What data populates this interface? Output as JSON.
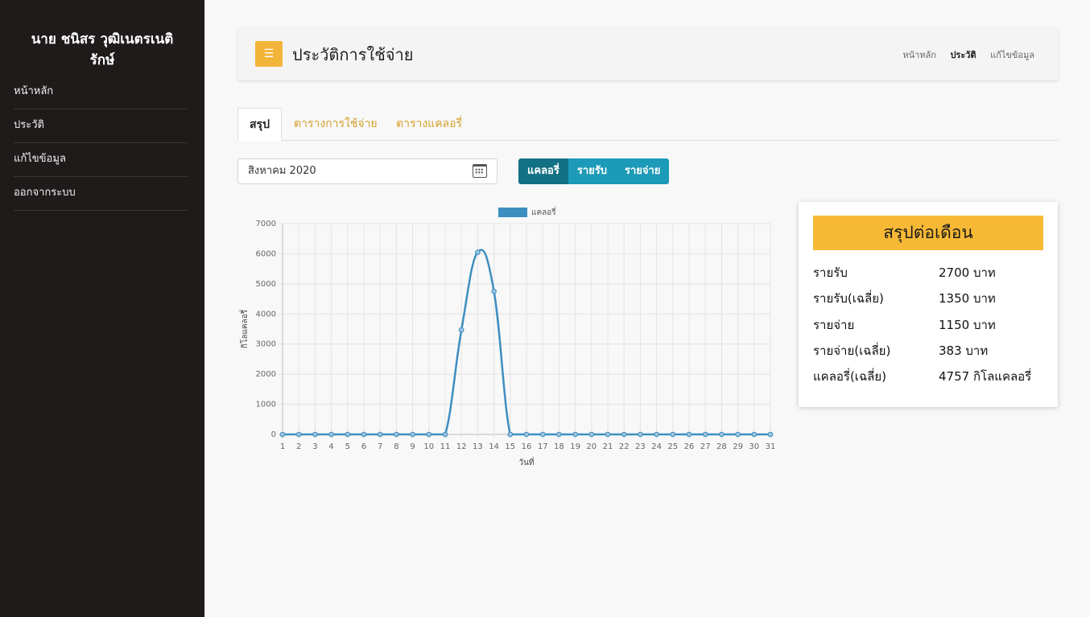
{
  "sidebar": {
    "user_name": "นาย ชนิสร วุฒิเนตรเนติรักษ์",
    "items": [
      {
        "label": "หน้าหลัก"
      },
      {
        "label": "ประวัติ"
      },
      {
        "label": "แก้ไขข้อมูล"
      },
      {
        "label": "ออกจากระบบ"
      }
    ]
  },
  "header": {
    "menu_icon": "list-icon",
    "title": "ประวัติการใช้จ่าย",
    "breadcrumbs": [
      "หน้าหลัก",
      "ประวัติ",
      "แก้ไขข้อมูล"
    ],
    "active_breadcrumb": "ประวัติ"
  },
  "tabs": [
    {
      "label": "สรุป",
      "active": true
    },
    {
      "label": "ตารางการใช้จ่าย",
      "active": false
    },
    {
      "label": "ตารางแคลอรี่",
      "active": false
    }
  ],
  "filters": {
    "month_value": "สิงหาคม 2020",
    "calendar_icon": "calendar-icon",
    "toggle": [
      "แคลอรี่",
      "รายรับ",
      "รายจ่าย"
    ],
    "active_toggle": "แคลอรี่"
  },
  "colors": {
    "accent": "#f7b935",
    "sidebar_bg": "#1e1b1a",
    "button": "#1c9ab8",
    "button_active": "#137185",
    "series": "#3e8ebf"
  },
  "chart_data": {
    "type": "line",
    "x": [
      "1",
      "2",
      "3",
      "4",
      "5",
      "6",
      "7",
      "8",
      "9",
      "10",
      "11",
      "12",
      "13",
      "14",
      "15",
      "16",
      "17",
      "18",
      "19",
      "20",
      "21",
      "22",
      "23",
      "24",
      "25",
      "26",
      "27",
      "28",
      "29",
      "30",
      "31"
    ],
    "series": [
      {
        "name": "แคลอรี่",
        "values": [
          0,
          0,
          0,
          0,
          0,
          0,
          0,
          0,
          0,
          0,
          0,
          3470,
          6050,
          4750,
          0,
          0,
          0,
          0,
          0,
          0,
          0,
          0,
          0,
          0,
          0,
          0,
          0,
          0,
          0,
          0,
          0
        ]
      }
    ],
    "xlabel": "วันที่",
    "ylabel": "กิโลแคลอรี่",
    "ylim": [
      0,
      7000
    ],
    "yticks": [
      "0",
      "1000",
      "2000",
      "3000",
      "4000",
      "5000",
      "6000",
      "7000"
    ],
    "grid": true,
    "legend": "top"
  },
  "summary": {
    "title": "สรุปต่อเดือน",
    "rows": [
      {
        "label": "รายรับ",
        "value": "2700 บาท"
      },
      {
        "label": "รายรับ(เฉลี่ย)",
        "value": "1350 บาท"
      },
      {
        "label": "รายจ่าย",
        "value": "1150 บาท"
      },
      {
        "label": "รายจ่าย(เฉลี่ย)",
        "value": "383 บาท"
      },
      {
        "label": "แคลอรี่(เฉลี่ย)",
        "value": "4757 กิโลแคลอรี่"
      }
    ]
  }
}
